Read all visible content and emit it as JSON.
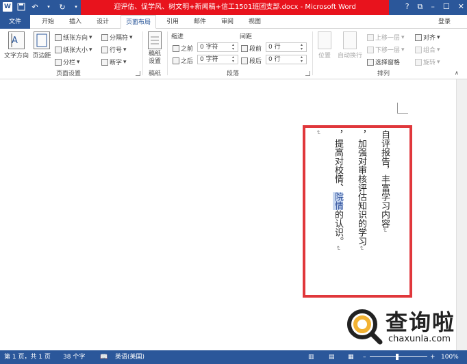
{
  "window": {
    "title": "迎评估、促学风、树文明+新闻稿+信工1501班团支部.docx - Microsoft Word",
    "controls": [
      "?",
      "⧉",
      "–",
      "☐",
      "✕"
    ]
  },
  "qat": {
    "app_icon": "W",
    "save": "save-icon",
    "undo": "undo-icon",
    "redo": "redo-icon"
  },
  "tabs": [
    "文件",
    "开始",
    "插入",
    "设计",
    "页面布局",
    "引用",
    "邮件",
    "审阅",
    "视图"
  ],
  "active_tab": "页面布局",
  "login": "登录",
  "ribbon": {
    "page_setup": {
      "label": "页面设置",
      "text_direction": "文字方向",
      "margins": "页边距",
      "orientation": "纸张方向",
      "size": "纸张大小",
      "columns": "分栏",
      "breaks": "分隔符",
      "line_numbers": "行号",
      "hyphenation": "断字"
    },
    "manuscript": {
      "label": "稿纸",
      "button": "稿纸\n设置"
    },
    "paragraph": {
      "label": "段落",
      "indent_header": "缩进",
      "spacing_header": "间距",
      "indent_before_label": "之前",
      "indent_before_value": "0 字符",
      "indent_after_label": "之后",
      "indent_after_value": "0 字符",
      "space_before_label": "段前",
      "space_before_value": "0 行",
      "space_after_label": "段后",
      "space_after_value": "0 行"
    },
    "arrange": {
      "label": "排列",
      "position": "位置",
      "wrap_text": "自动换行",
      "bring_forward": "上移一层",
      "send_backward": "下移一层",
      "selection_pane": "选择窗格",
      "align": "对齐",
      "group": "组合",
      "rotate": "旋转"
    }
  },
  "document": {
    "col1": "自评报告，丰富学习内容",
    "col2": "，加强对审核评估知识的学习",
    "col3_a": "，提高对校情、",
    "col3_hl": "院情",
    "col3_b": "的认识。",
    "para_mark": "↵"
  },
  "watermark": {
    "brand": "查询啦",
    "url": "chaxunla.com"
  },
  "status": {
    "page": "第 1 页，共 1 页",
    "words": "38 个字",
    "language": "英语(美国)",
    "zoom": "100%"
  }
}
